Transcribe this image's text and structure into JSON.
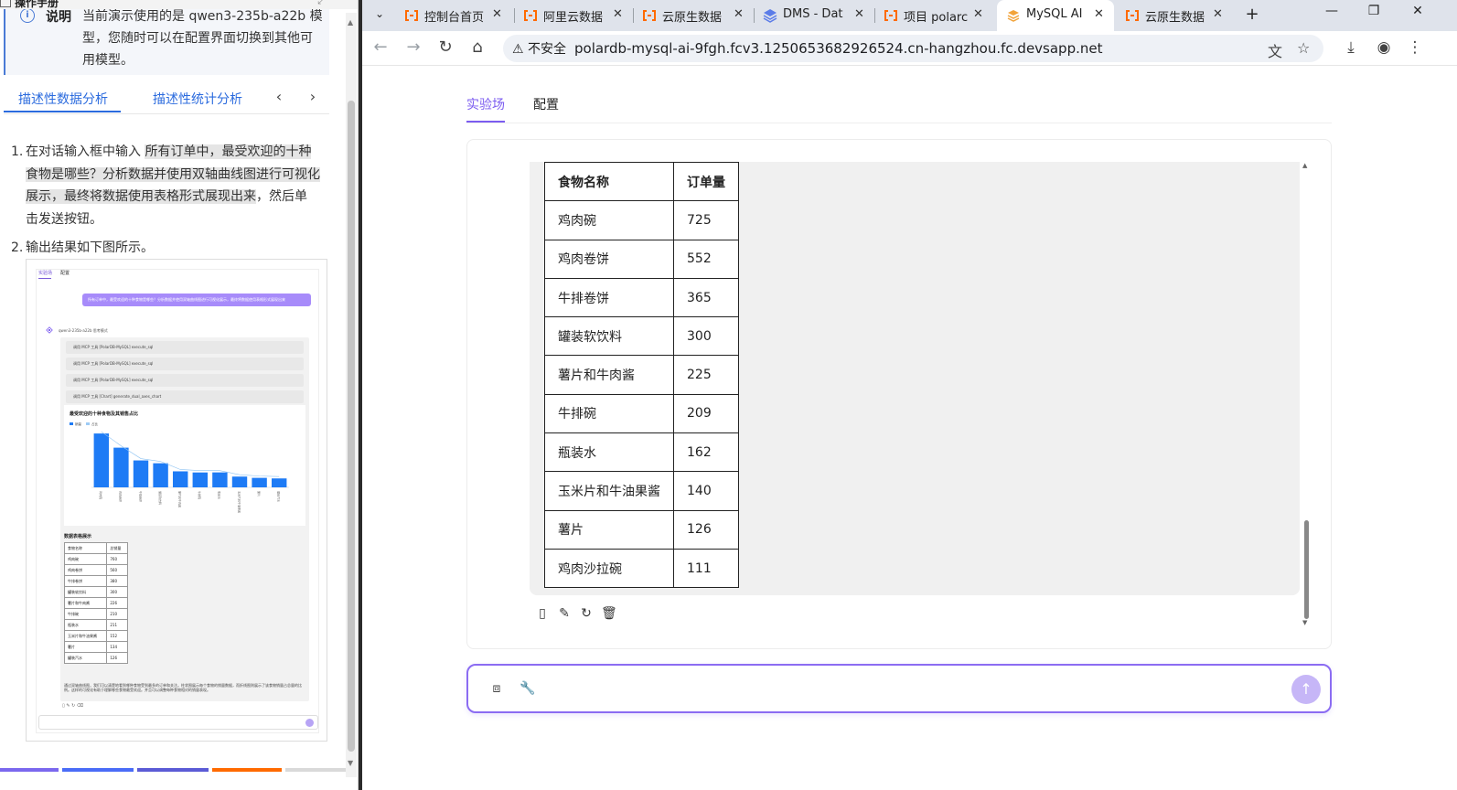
{
  "manual": {
    "title": "操作手册",
    "note_label": "说明",
    "note_lines": [
      "当前演示使用的是 qwen3-235b-a22b 模",
      "型，您随时可以在配置界面切换到其他可",
      "用模型。"
    ],
    "tabs": [
      "描述性数据分析",
      "描述性统计分析"
    ],
    "step1_lines": [
      "在对话输入框中输入",
      "所有订单中，最受欢迎的十种",
      "食物是哪些？分析数据并使用双轴曲线图进行可视化",
      "展示，最终将数据使用表格形式展现出来",
      "，然后单",
      "击发送按钮。"
    ],
    "step2": "输出结果如下图所示。",
    "thumbnail": {
      "tab_lab": "实验场",
      "tab_config": "配置",
      "bubble": "所有订单中，最受欢迎的十种食物是哪些？分析数据并使用双轴曲线图进行可视化展示，最终将数据使用表格形式展现出来",
      "model": "qwen3-235b-a22b  思考模式",
      "tool_calls": [
        "调用 MCP 工具  [PolarDB-MySQL]  execute_sql",
        "调用 MCP 工具  [PolarDB-MySQL]  execute_sql",
        "调用 MCP 工具  [PolarDB-MySQL]  execute_sql",
        "调用 MCP 工具  [Chart]  generate_dual_axes_chart"
      ],
      "chart_title": "最受欢迎的十种食物及其销售占比",
      "table_title": "数据表格展示",
      "table_header": [
        "食物名称",
        "总销量"
      ],
      "table_rows": [
        [
          "鸡肉碗",
          "760"
        ],
        [
          "鸡肉卷饼",
          "560"
        ],
        [
          "牛排卷饼",
          "380"
        ],
        [
          "罐装软饮料",
          "300"
        ],
        [
          "薯片和牛肉酱",
          "226"
        ],
        [
          "牛排碗",
          "210"
        ],
        [
          "瓶装水",
          "211"
        ],
        [
          "玉米片和牛油果酱",
          "152"
        ],
        [
          "薯片",
          "134"
        ],
        [
          "罐装汽水",
          "126"
        ]
      ],
      "footnote": "通过双轴曲线图，我们可以清楚地看到哪种食物受到最多的订单和关注。柱状图展示每个食物的销量数据，而折线图则展示了该食物销量占总量的比例。这样的可视化有助于理解哪些食物最受欢迎。并且可以调整每种食物相对的销量表现。",
      "chart_data": {
        "type": "bar",
        "categories": [
          "鸡肉碗",
          "鸡肉卷饼",
          "牛排卷饼",
          "罐装软饮料",
          "薯片和牛肉酱",
          "牛排碗",
          "瓶装水",
          "玉米片和牛油果酱",
          "薯片",
          "罐装汽水"
        ],
        "series": [
          {
            "name": "销量",
            "values": [
              760,
              560,
              380,
              340,
              226,
              210,
              211,
              152,
              134,
              126
            ]
          }
        ],
        "legend": [
          "销量",
          "占比"
        ],
        "ylim": [
          0,
          800
        ]
      }
    }
  },
  "browser": {
    "tabs": [
      {
        "title": "控制台首页",
        "icon": "aliyun"
      },
      {
        "title": "阿里云数据",
        "icon": "aliyun"
      },
      {
        "title": "云原生数据",
        "icon": "aliyun"
      },
      {
        "title": "DMS - Dat",
        "icon": "dms"
      },
      {
        "title": "项目 polarc",
        "icon": "aliyun"
      },
      {
        "title": "MySQL AI",
        "icon": "mysql"
      },
      {
        "title": "云原生数据",
        "icon": "aliyun"
      }
    ],
    "security_label": "不安全",
    "url": "polardb-mysql-ai-9fgh.fcv3.1250653682926524.cn-hangzhou.fc.devsapp.net"
  },
  "app": {
    "tabs": [
      "实验场",
      "配置"
    ],
    "table": {
      "headers": [
        "食物名称",
        "订单量"
      ],
      "rows": [
        [
          "鸡肉碗",
          "725"
        ],
        [
          "鸡肉卷饼",
          "552"
        ],
        [
          "牛排卷饼",
          "365"
        ],
        [
          "罐装软饮料",
          "300"
        ],
        [
          "薯片和牛肉酱",
          "225"
        ],
        [
          "牛排碗",
          "209"
        ],
        [
          "瓶装水",
          "162"
        ],
        [
          "玉米片和牛油果酱",
          "140"
        ],
        [
          "薯片",
          "126"
        ],
        [
          "鸡肉沙拉碗",
          "111"
        ]
      ]
    },
    "input_placeholder": ""
  },
  "colors": {
    "accent": "#7c5cf0",
    "link": "#2b6bde",
    "bar": "#1e7bf5",
    "aliyun": "#ff6a00"
  }
}
